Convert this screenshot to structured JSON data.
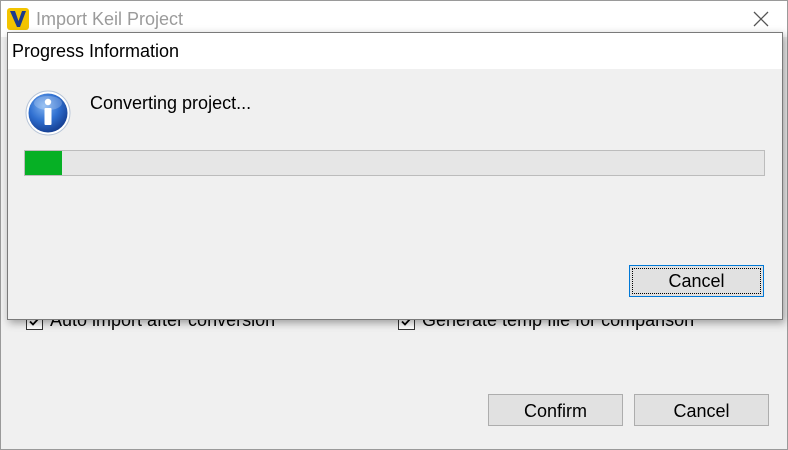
{
  "main_window": {
    "title": "Import Keil Project",
    "options": {
      "auto_import_label": "Auto import after conversion",
      "auto_import_checked": true,
      "generate_temp_label": "Generate temp file for comparison",
      "generate_temp_checked": true
    },
    "confirm_label": "Confirm",
    "cancel_label": "Cancel"
  },
  "progress_dialog": {
    "title": "Progress Information",
    "icon": "info-icon",
    "message": "Converting project...",
    "progress_fraction": 0.05,
    "progress_color": "#06b025",
    "cancel_label": "Cancel"
  }
}
